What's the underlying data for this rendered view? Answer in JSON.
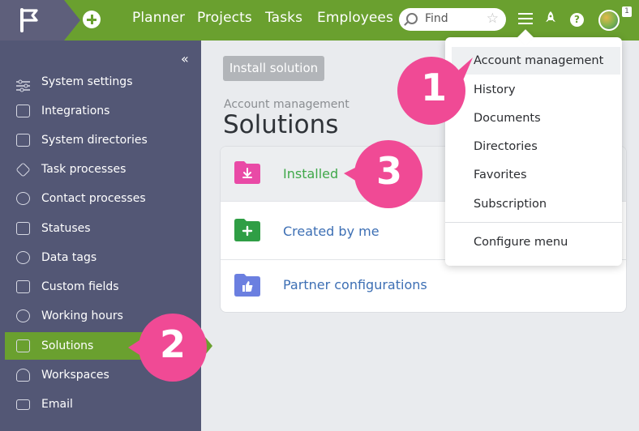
{
  "topbar": {
    "nav": [
      "Planner",
      "Projects",
      "Tasks",
      "Employees"
    ],
    "search_placeholder": "Find",
    "avatar_badge": "1",
    "colors": {
      "brand_green": "#6aa02f",
      "logo_bg": "#5e5f7b"
    }
  },
  "sidebar": {
    "collapse_icon": "«",
    "items": [
      {
        "label": "System settings",
        "icon": "sliders-icon"
      },
      {
        "label": "Integrations",
        "icon": "integrations-icon"
      },
      {
        "label": "System directories",
        "icon": "directories-icon"
      },
      {
        "label": "Task processes",
        "icon": "task-process-icon"
      },
      {
        "label": "Contact processes",
        "icon": "contact-process-icon"
      },
      {
        "label": "Statuses",
        "icon": "statuses-icon"
      },
      {
        "label": "Data tags",
        "icon": "tag-icon"
      },
      {
        "label": "Custom fields",
        "icon": "fields-icon"
      },
      {
        "label": "Working hours",
        "icon": "clock-icon"
      },
      {
        "label": "Solutions",
        "icon": "solutions-icon",
        "active": true
      },
      {
        "label": "Workspaces",
        "icon": "rocket-icon"
      },
      {
        "label": "Email",
        "icon": "mail-icon"
      }
    ]
  },
  "main": {
    "install_button": "Install solution",
    "breadcrumb": "Account management",
    "title": "Solutions",
    "rows": [
      {
        "label": "Installed",
        "color": "#40a84a",
        "icon": "download-folder-icon"
      },
      {
        "label": "Created by me",
        "color": "#3d6fb4",
        "icon": "add-folder-icon"
      },
      {
        "label": "Partner configurations",
        "color": "#3d6fb4",
        "icon": "thumbs-up-folder-icon"
      }
    ]
  },
  "dropdown": {
    "items": [
      "Account management",
      "History",
      "Documents",
      "Directories",
      "Favorites",
      "Subscription"
    ],
    "footer": "Configure menu"
  },
  "markers": [
    "1",
    "2",
    "3"
  ]
}
